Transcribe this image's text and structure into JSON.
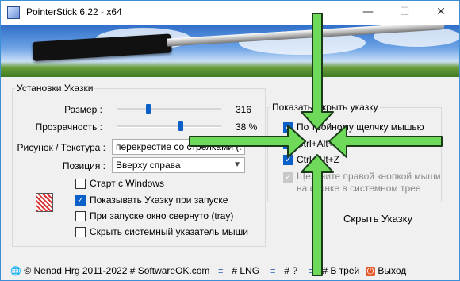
{
  "window": {
    "title": "PointerStick 6.22 - x64",
    "minimize": "—",
    "maximize": "☐",
    "close": "✕"
  },
  "settings": {
    "group_title": "Установки Указки",
    "size_label": "Размер :",
    "size_value": 316,
    "size_display": "316",
    "transparency_label": "Прозрачность :",
    "transparency_value": 38,
    "transparency_display": "38 %",
    "texture_label": "Рисунок / Текстура :",
    "texture_value": "перекрестие со стрелками (.",
    "position_label": "Позиция :",
    "position_value": "Вверху справа"
  },
  "checks": [
    {
      "label": "Старт с Windows",
      "checked": false
    },
    {
      "label": "Показывать Указку при запуске",
      "checked": true
    },
    {
      "label": "При запуске окно свернуто (tray)",
      "checked": false
    },
    {
      "label": "Скрыть системный указатель мыши",
      "checked": false
    }
  ],
  "toggle": {
    "group_title": "Показать/Скрыть указку",
    "options": [
      {
        "label": "По тройному щелчку мышью",
        "checked": true
      },
      {
        "label": "Ctrl+Alt+Y",
        "checked": true
      },
      {
        "label": "Ctrl+Alt+Z",
        "checked": true
      }
    ],
    "disabled_option": {
      "label": "Щелкните правой кнопкой мыши на иконке в системном трее",
      "line1": "Щелкните правой кнопкой мыши",
      "line2": "на иконке в системном трее",
      "checked": true
    },
    "hide_button": "Скрыть Указку"
  },
  "statusbar": {
    "copyright": "© Nenad Hrg 2011-2022 # SoftwareOK.com",
    "lng": "# LNG",
    "help": "# ?",
    "tray": "# В трей",
    "exit": "Выход"
  },
  "colors": {
    "accent": "#0a5fc9",
    "arrow_fill": "#6fd95a",
    "arrow_outline": "#1a3a1a"
  },
  "icons": {
    "app": "pointerstick-app-icon",
    "globe": "globe-icon",
    "menu": "menu-icon",
    "exit": "power-exit-icon"
  }
}
